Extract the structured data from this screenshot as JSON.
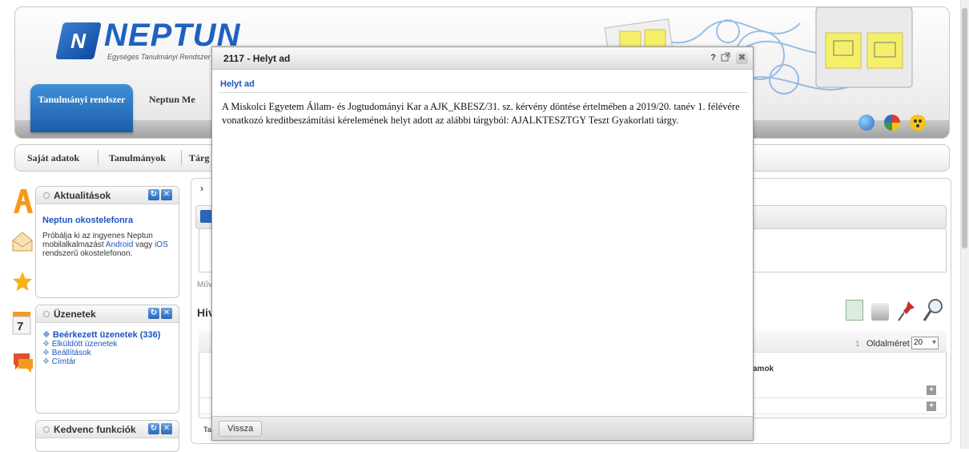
{
  "header": {
    "logo_text": "NEPTUN",
    "logo_subtitle": "Egységes Tanulmányi Rendszer",
    "tabs": [
      {
        "label": "Tanulmányi rendszer",
        "active": true
      },
      {
        "label": "Neptun Me"
      }
    ]
  },
  "main_menu": {
    "items": [
      "Saját adatok",
      "Tanulmányok",
      "Tárg"
    ]
  },
  "boxes": {
    "aktualitasok": {
      "title": "Aktualitások",
      "headline": "Neptun okostelefonra",
      "text_a": "Próbálja ki az ingyenes Neptun mobilalkalmazást ",
      "link_android": "Android",
      "text_b": " vagy ",
      "link_ios": "iOS",
      "text_c": " rendszerű okostelefonon."
    },
    "uzenetek": {
      "title": "Üzenetek",
      "items": [
        "Beérkezett üzenetek (336)",
        "Elküldött üzenetek",
        "Beállítások",
        "Címtár"
      ]
    },
    "kedvenc": {
      "title": "Kedvenc funkciók"
    }
  },
  "content": {
    "muv_label": "Műv",
    "hiv_label": "Hiv",
    "page_number": "1",
    "page_size_label": "Oldalméret",
    "page_size_value": "20",
    "column_fragment": "amok",
    "footer_fragment": "Ta"
  },
  "modal": {
    "title": "2117 - Helyt ad",
    "help": "?",
    "close": "✖",
    "subheading": "Helyt ad",
    "body": "A Miskolci Egyetem Állam- és Jogtudományi Kar a AJK_KBESZ/31. sz. kérvény döntése értelmében a 2019/20. tanév 1. félévére vonatkozó kreditbeszámítási kérelemének helyt adott az alábbi tárgyból: AJALKTESZTGY Teszt Gyakorlati tárgy.",
    "back_label": "Vissza"
  },
  "colors": {
    "brand_blue": "#1e62c0",
    "link_blue": "#1a55c2",
    "accent_orange": "#f39a1e"
  }
}
